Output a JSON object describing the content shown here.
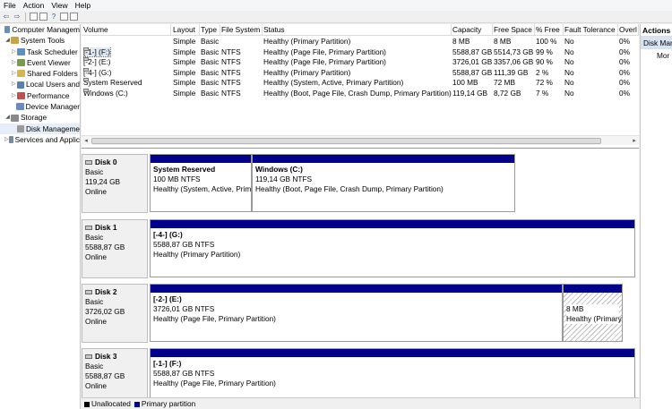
{
  "menu": [
    "File",
    "Action",
    "View",
    "Help"
  ],
  "tree": [
    {
      "label": "Computer Managem",
      "indent": 0,
      "arrow": "",
      "color": "#6a8bbf"
    },
    {
      "label": "System Tools",
      "indent": 1,
      "arrow": "◢",
      "color": "#c8a24a"
    },
    {
      "label": "Task Scheduler",
      "indent": 2,
      "arrow": "▷",
      "color": "#5f8fc0"
    },
    {
      "label": "Event Viewer",
      "indent": 2,
      "arrow": "▷",
      "color": "#7a9a4a"
    },
    {
      "label": "Shared Folders",
      "indent": 2,
      "arrow": "▷",
      "color": "#d6b450"
    },
    {
      "label": "Local Users and",
      "indent": 2,
      "arrow": "▷",
      "color": "#5a7fb0"
    },
    {
      "label": "Performance",
      "indent": 2,
      "arrow": "▷",
      "color": "#c0504d"
    },
    {
      "label": "Device Manager",
      "indent": 2,
      "arrow": "",
      "color": "#6a8bbf"
    },
    {
      "label": "Storage",
      "indent": 1,
      "arrow": "◢",
      "color": "#8a8a8a"
    },
    {
      "label": "Disk Manageme",
      "indent": 2,
      "arrow": "",
      "color": "#9a9a9a",
      "selected": true
    },
    {
      "label": "Services and Applic",
      "indent": 1,
      "arrow": "▷",
      "color": "#7a8aa0"
    }
  ],
  "volume_table": {
    "headers": [
      "Volume",
      "Layout",
      "Type",
      "File System",
      "Status",
      "Capacity",
      "Free Space",
      "% Free",
      "Fault Tolerance",
      "Overl"
    ],
    "rows": [
      [
        "",
        "Simple",
        "Basic",
        "",
        "Healthy (Primary Partition)",
        "8 MB",
        "8 MB",
        "100 %",
        "No",
        "0%"
      ],
      [
        "[-1-] (F:)",
        "Simple",
        "Basic",
        "NTFS",
        "Healthy (Page File, Primary Partition)",
        "5588,87 GB",
        "5514,73 GB",
        "99 %",
        "No",
        "0%"
      ],
      [
        "[-2-] (E:)",
        "Simple",
        "Basic",
        "NTFS",
        "Healthy (Page File, Primary Partition)",
        "3726,01 GB",
        "3357,06 GB",
        "90 %",
        "No",
        "0%"
      ],
      [
        "[-4-] (G:)",
        "Simple",
        "Basic",
        "NTFS",
        "Healthy (Primary Partition)",
        "5588,87 GB",
        "111,39 GB",
        "2 %",
        "No",
        "0%"
      ],
      [
        "System Reserved",
        "Simple",
        "Basic",
        "NTFS",
        "Healthy (System, Active, Primary Partition)",
        "100 MB",
        "72 MB",
        "72 %",
        "No",
        "0%"
      ],
      [
        "Windows (C:)",
        "Simple",
        "Basic",
        "NTFS",
        "Healthy (Boot, Page File, Crash Dump, Primary Partition)",
        "119,14 GB",
        "8,72 GB",
        "7 %",
        "No",
        "0%"
      ]
    ]
  },
  "disks": [
    {
      "name": "Disk 0",
      "type": "Basic",
      "size": "119,24 GB",
      "state": "Online",
      "partitions": [
        {
          "title": "System Reserved",
          "size": "100 MB NTFS",
          "status": "Healthy (System, Active, Prima"
        },
        {
          "title": "Windows  (C:)",
          "size": "119,14 GB NTFS",
          "status": "Healthy (Boot, Page File, Crash Dump, Primary Partition)"
        }
      ]
    },
    {
      "name": "Disk 1",
      "type": "Basic",
      "size": "5588,87 GB",
      "state": "Online",
      "partitions": [
        {
          "title": "[-4-]  (G:)",
          "size": "5588,87 GB NTFS",
          "status": "Healthy (Primary Partition)"
        }
      ]
    },
    {
      "name": "Disk 2",
      "type": "Basic",
      "size": "3726,02 GB",
      "state": "Online",
      "partitions": [
        {
          "title": "[-2-]  (E:)",
          "size": "3726,01 GB NTFS",
          "status": "Healthy (Page File, Primary Partition)"
        },
        {
          "title": "",
          "size": "8 MB",
          "status": "Healthy (Primary"
        }
      ]
    },
    {
      "name": "Disk 3",
      "type": "Basic",
      "size": "5588,87 GB",
      "state": "Online",
      "partitions": [
        {
          "title": "[-1-]  (F:)",
          "size": "5588,87 GB NTFS",
          "status": "Healthy (Page File, Primary Partition)"
        }
      ]
    }
  ],
  "legend": {
    "unallocated": "Unallocated",
    "primary": "Primary partition",
    "unallocated_color": "#000000",
    "primary_color": "#00008b"
  },
  "actions": {
    "title": "Actions",
    "section": "Disk Mar",
    "more": "Mor"
  }
}
